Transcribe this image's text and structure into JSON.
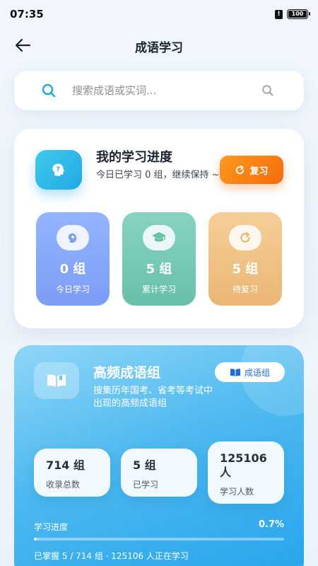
{
  "status_bar": {
    "time": "07:35",
    "alert_glyph": "!",
    "battery": "100"
  },
  "header": {
    "title": "成语学习"
  },
  "search": {
    "placeholder": "搜索成语或实词..."
  },
  "progress_card": {
    "title": "我的学习进度",
    "subtitle": "今日已学习 0 组，继续保持 ~",
    "review_label": "复习",
    "badge_glyph": "?",
    "stats": [
      {
        "value": "0 组",
        "label": "今日学习",
        "icon": "brain-icon"
      },
      {
        "value": "5 组",
        "label": "累计学习",
        "icon": "graduation-cap-icon"
      },
      {
        "value": "5 组",
        "label": "待复习",
        "icon": "refresh-icon"
      }
    ]
  },
  "hf_card": {
    "title": "高频成语组",
    "description": "搜集历年国考、省考等考试中出现的高频成语组",
    "idiom_button": "成语组",
    "stats": [
      {
        "value": "714 组",
        "label": "收录总数"
      },
      {
        "value": "5 组",
        "label": "已学习"
      },
      {
        "value": "125106 人",
        "label": "学习人数"
      }
    ],
    "progress_label": "学习进度",
    "progress_percent": "0.7%",
    "progress_fraction": 0.007,
    "progress_note": "已掌握 5 / 714 组 · 125106 人正在学习"
  },
  "colors": {
    "accent_blue": "#23a8e6",
    "review_orange": "#f26b0c",
    "tile_blue": "#7c9df4",
    "tile_green": "#68c0a9",
    "tile_orange": "#eab674"
  }
}
